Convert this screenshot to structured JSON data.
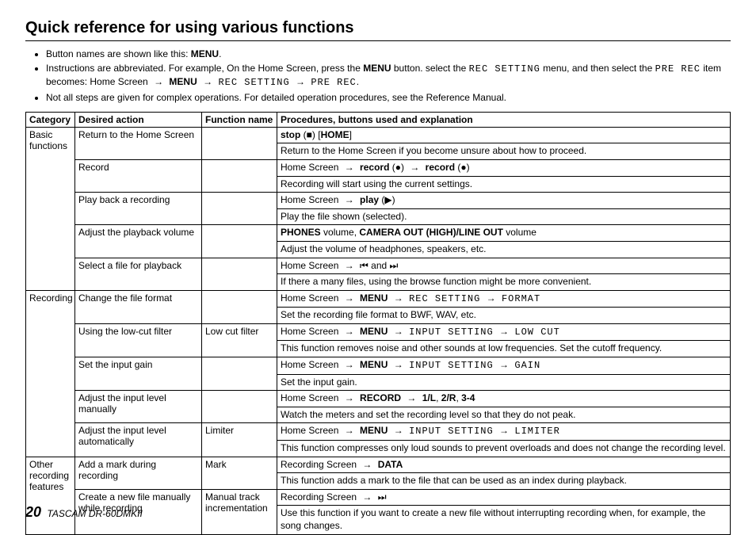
{
  "title": "Quick reference for using various functions",
  "notes": {
    "n1a": "Button names are shown like this: ",
    "n1b": "MENU",
    "n1c": ".",
    "n2a": "Instructions are abbreviated. For example, On the Home Screen, press the ",
    "n2b": "MENU",
    "n2c": " button. select the ",
    "n2d": "REC SETTING",
    "n2e": " menu, and then select the ",
    "n2f": "PRE REC",
    "n2g": " item becomes: Home Screen ",
    "n2h": "MENU",
    "n2i": "REC SETTING",
    "n2j": "PRE REC",
    "n2k": ".",
    "n3": "Not all steps are given for complex operations. For detailed operation procedures, see the Reference Manual."
  },
  "arrowGlyph": "→",
  "headers": {
    "category": "Category",
    "desired": "Desired action",
    "fname": "Function name",
    "proc": "Procedures, buttons used and explanation"
  },
  "categories": {
    "basic": "Basic functions",
    "recording": "Recording",
    "other": "Other recording features"
  },
  "rows": {
    "r1": {
      "desired": "Return to the Home Screen",
      "p1a": "stop",
      "p1b": " (■) [",
      "p1c": "HOME",
      "p1d": "]",
      "p2": "Return to the Home Screen if you become unsure about how to proceed."
    },
    "r2": {
      "desired": "Record",
      "p1a": "Home Screen ",
      "p1b": "record",
      "p1c": " (●) ",
      "p1d": "record",
      "p1e": " (●)",
      "p2": "Recording will start using the current settings."
    },
    "r3": {
      "desired": "Play back a recording",
      "p1a": "Home Screen ",
      "p1b": "play",
      "p1c": " (▶)",
      "p2": "Play the file shown (selected)."
    },
    "r4": {
      "desired": "Adjust the playback volume",
      "p1a": "PHONES",
      "p1b": " volume, ",
      "p1c": "CAMERA OUT (HIGH)/LINE OUT",
      "p1d": " volume",
      "p2": "Adjust the volume of headphones, speakers, etc."
    },
    "r5": {
      "desired": "Select a file for playback",
      "p1a": "Home Screen ",
      "p1b": " ⏮ and ⏭",
      "p2": "If there a many files, using the browse function might be more convenient."
    },
    "r6": {
      "desired": "Change the file format",
      "p1a": "Home Screen ",
      "p1b": "MENU",
      "p1c": "REC SETTING",
      "p1d": "FORMAT",
      "p2": "Set the recording file format to BWF, WAV, etc."
    },
    "r7": {
      "desired": "Using the low-cut filter",
      "fname": "Low cut filter",
      "p1a": "Home Screen ",
      "p1b": "MENU",
      "p1c": "INPUT SETTING",
      "p1d": "LOW CUT",
      "p2": "This function removes noise and other sounds at low frequencies. Set the cutoff frequency."
    },
    "r8": {
      "desired": "Set the input gain",
      "p1a": "Home Screen ",
      "p1b": "MENU",
      "p1c": "INPUT SETTING",
      "p1d": "GAIN",
      "p2": "Set the input gain."
    },
    "r9": {
      "desired": "Adjust the input level manually",
      "p1a": "Home Screen ",
      "p1b": "RECORD",
      "p1c": "1/L",
      "p1d": ", ",
      "p1e": "2/R",
      "p1f": ", ",
      "p1g": "3-4",
      "p2": "Watch the meters and set the recording level so that they do not peak."
    },
    "r10": {
      "desired": "Adjust the input level automatically",
      "fname": "Limiter",
      "p1a": "Home Screen ",
      "p1b": "MENU",
      "p1c": "INPUT SETTING",
      "p1d": "LIMITER",
      "p2": "This function compresses only loud sounds to prevent overloads and does not change the recording level."
    },
    "r11": {
      "desired": "Add a mark during recording",
      "fname": "Mark",
      "p1a": "Recording Screen ",
      "p1b": "DATA",
      "p2": "This function adds a mark to the file that can be used as an index during playback."
    },
    "r12": {
      "desired": "Create a new file manually while recording",
      "fname": "Manual track incrementation",
      "p1a": "Recording Screen ",
      "p1b": " ⏭",
      "p2": "Use this function if you want to create a new file without interrupting recording when, for example, the song changes."
    }
  },
  "footer": {
    "page": "20",
    "model": "TASCAM  DR-60DMKII"
  }
}
